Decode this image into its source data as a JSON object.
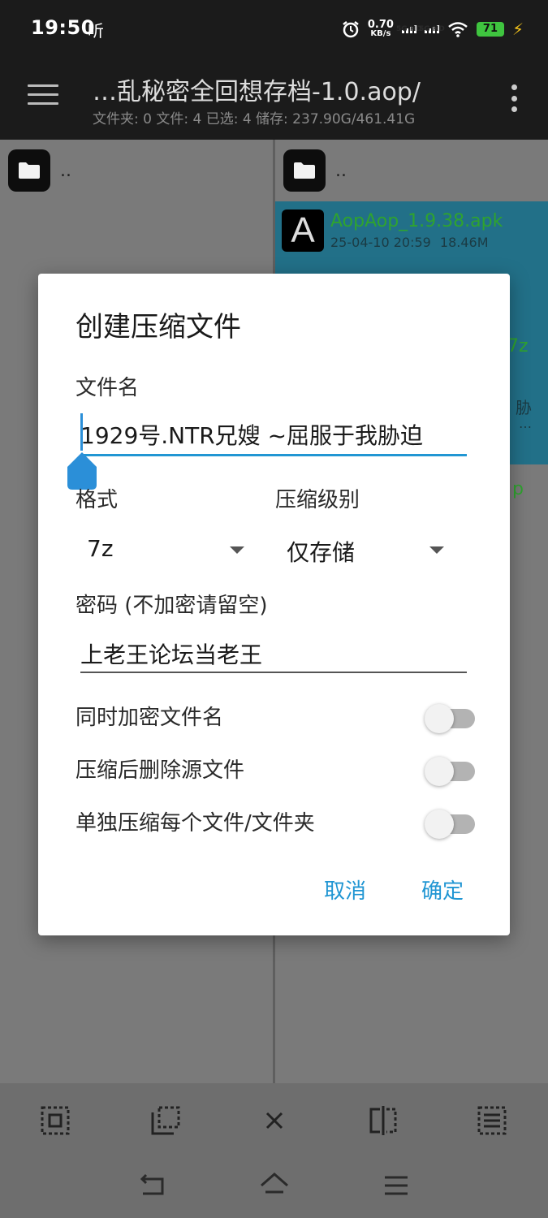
{
  "status_bar": {
    "time": "19:50",
    "extra_label": "听",
    "speed_value": "0.70",
    "speed_unit": "KB/s",
    "sim1_label": "5G HD",
    "sim2_label": "5G HD",
    "battery_level": "71"
  },
  "header": {
    "path_title": "…乱秘密全回想存档-1.0.aop/",
    "path_stats": "文件夹: 0  文件: 4  已选: 4  储存: 237.90G/461.41G"
  },
  "left_pane": {
    "parent_label": ".."
  },
  "right_pane": {
    "parent_label": "..",
    "file": {
      "icon_letter": "A",
      "name": "AopAop_1.9.38.apk",
      "date": "25-04-10 20:59",
      "size": "18.46M"
    },
    "peek_texts": [
      "7z",
      "胁",
      "…",
      "p"
    ]
  },
  "dialog": {
    "title": "创建压缩文件",
    "filename_label": "文件名",
    "filename_value": "1929号.NTR兄嫂 ~屈服于我胁迫",
    "format_label": "格式",
    "format_value": "7z",
    "level_label": "压缩级别",
    "level_value": "仅存储",
    "password_label": "密码 (不加密请留空)",
    "password_value": "上老王论坛当老王",
    "switches": [
      {
        "label": "同时加密文件名",
        "on": false
      },
      {
        "label": "压缩后删除源文件",
        "on": false
      },
      {
        "label": "单独压缩每个文件/文件夹",
        "on": false
      }
    ],
    "cancel_label": "取消",
    "ok_label": "确定"
  },
  "colors": {
    "accent": "#2196d3",
    "selected_bg": "#227088",
    "file_name": "#2fa32f"
  }
}
